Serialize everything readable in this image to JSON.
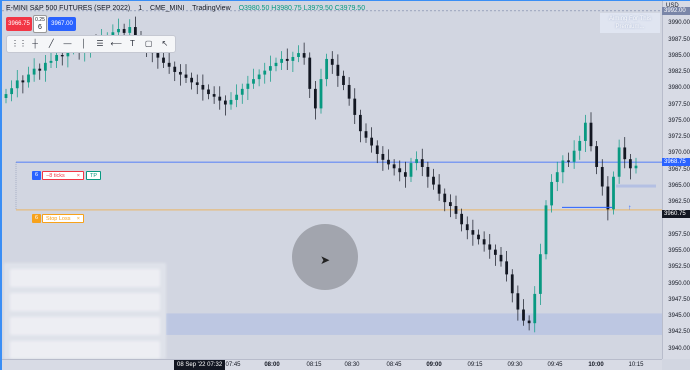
{
  "header": {
    "symbol": "E-MINI S&P 500 FUTURES (SEP 2022)",
    "interval": "1",
    "exchange": "CME_MINI",
    "source": "TradingView",
    "ohlc": "O3980.50 H3980.75 L3979.50 C3979.50"
  },
  "quote": {
    "sell_price": "3966.75",
    "spread_top": "0.25",
    "spread_qty": "6",
    "buy_price": "3967.00"
  },
  "toolbar": {
    "tools": [
      "drag-handle",
      "crosshair",
      "trend-line",
      "horizontal-line",
      "vertical-line",
      "fib-tool",
      "arrow",
      "text",
      "rectangle",
      "cursor-arrow"
    ]
  },
  "promo": {
    "text": "Aiming For This Premium..."
  },
  "price_axis": {
    "currency": "USD",
    "ticks": [
      "3990.00",
      "3987.50",
      "3985.00",
      "3982.50",
      "3980.00",
      "3977.50",
      "3975.00",
      "3972.50",
      "3970.00",
      "3967.50",
      "3965.00",
      "3962.50",
      "3957.50",
      "3955.00",
      "3952.50",
      "3950.00",
      "3947.50",
      "3945.00",
      "3942.50",
      "3940.00"
    ],
    "labels": {
      "top": "3992.00",
      "tp": "3968.75",
      "current": "3960.75",
      "sl_hidden": ""
    }
  },
  "time_axis": {
    "date_badge": "08 Sep '22   07:32",
    "ticks": [
      {
        "label": "07:45",
        "bold": false
      },
      {
        "label": "08:00",
        "bold": true
      },
      {
        "label": "08:15",
        "bold": false
      },
      {
        "label": "08:30",
        "bold": false
      },
      {
        "label": "08:45",
        "bold": false
      },
      {
        "label": "09:00",
        "bold": true
      },
      {
        "label": "09:15",
        "bold": false
      },
      {
        "label": "09:30",
        "bold": false
      },
      {
        "label": "09:45",
        "bold": false
      },
      {
        "label": "10:00",
        "bold": true
      },
      {
        "label": "10:15",
        "bold": false
      }
    ]
  },
  "orders": {
    "tp_qty": "6",
    "tp_ticks": "−8 ticks",
    "tp_close": "×",
    "tp_label": "TP",
    "sl_qty": "6",
    "sl_label": "Stop Loss",
    "sl_close": "×"
  },
  "colors": {
    "up": "#089981",
    "down": "#131722",
    "tp_line": "#2962ff",
    "sl_line": "#f7a21b",
    "zone": "#b4c0e3"
  },
  "chart_data": {
    "type": "candlestick",
    "title": "",
    "ylim": [
      3938.5,
      3993.5
    ],
    "y_ticks": [
      3940,
      3942.5,
      3945,
      3947.5,
      3950,
      3952.5,
      3955,
      3957.5,
      3962.5,
      3965,
      3967.5,
      3970,
      3972.5,
      3975,
      3977.5,
      3980,
      3982.5,
      3985,
      3987.5,
      3990
    ],
    "closes": [
      3979.2,
      3980.1,
      3981.3,
      3981.0,
      3982.2,
      3983.1,
      3982.8,
      3984.0,
      3984.3,
      3985.2,
      3985.0,
      3986.1,
      3986.3,
      3985.6,
      3986.5,
      3987.2,
      3986.9,
      3987.6,
      3987.9,
      3988.7,
      3989.2,
      3988.6,
      3989.5,
      3988.1,
      3986.9,
      3986.0,
      3985.5,
      3984.8,
      3984.0,
      3983.4,
      3982.6,
      3982.2,
      3981.7,
      3981.0,
      3980.6,
      3979.9,
      3979.2,
      3978.8,
      3978.2,
      3977.6,
      3978.3,
      3979.1,
      3980.0,
      3980.8,
      3981.5,
      3982.2,
      3982.8,
      3983.5,
      3984.0,
      3984.6,
      3984.3,
      3984.9,
      3985.5,
      3984.8,
      3980.0,
      3977.0,
      3981.5,
      3984.6,
      3983.7,
      3982.0,
      3980.6,
      3978.5,
      3976.0,
      3973.5,
      3972.5,
      3971.3,
      3970.0,
      3969.1,
      3968.4,
      3967.8,
      3967.2,
      3966.5,
      3968.6,
      3969.2,
      3968.0,
      3966.5,
      3965.3,
      3963.9,
      3962.6,
      3962.0,
      3960.8,
      3959.2,
      3958.3,
      3957.6,
      3956.9,
      3956.1,
      3955.3,
      3954.5,
      3953.5,
      3951.5,
      3948.6,
      3946.1,
      3944.4,
      3944.0,
      3948.5,
      3954.6,
      3962.1,
      3965.7,
      3967.2,
      3969.0,
      3968.8,
      3970.5,
      3972.0,
      3974.8,
      3971.2,
      3968.0,
      3965.0,
      3961.5,
      3966.5,
      3971.0,
      3969.2,
      3967.8,
      3968.2
    ]
  }
}
